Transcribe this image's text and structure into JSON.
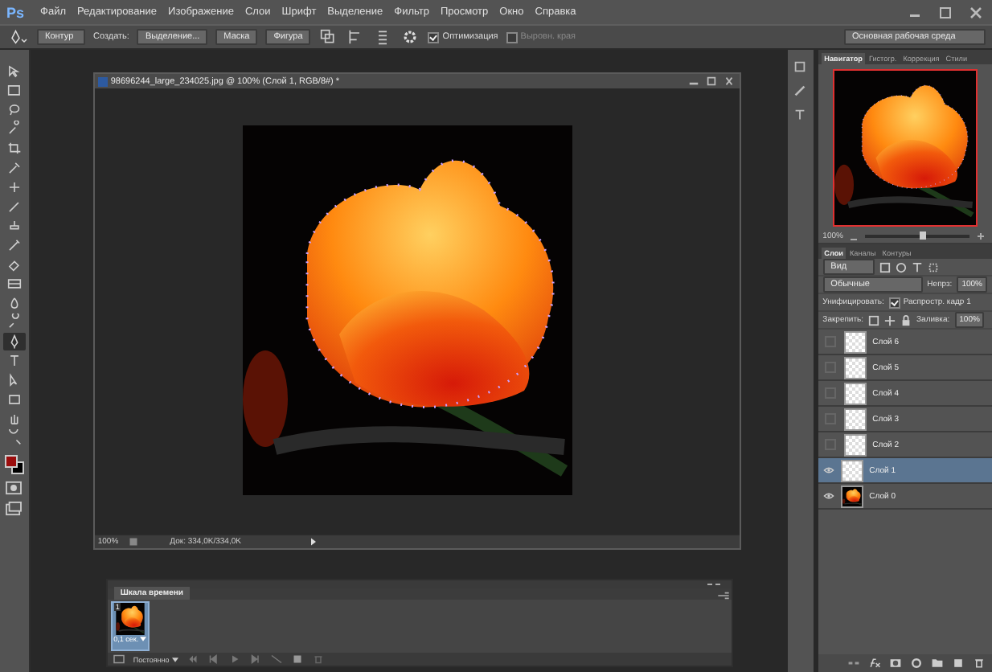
{
  "menu": {
    "logo": "Ps",
    "items": [
      "Файл",
      "Редактирование",
      "Изображение",
      "Слои",
      "Шрифт",
      "Выделение",
      "Фильтр",
      "Просмотр",
      "Окно",
      "Справка"
    ]
  },
  "options_bar": {
    "mode": "Контур",
    "create_label": "Создать:",
    "buttons": [
      "Выделение...",
      "Маска",
      "Фигура"
    ],
    "checkboxes": [
      {
        "label": "Оптимизация",
        "checked": true,
        "disabled": false
      },
      {
        "label": "Выровн. края",
        "checked": false,
        "disabled": true
      }
    ],
    "workspace": "Основная рабочая среда"
  },
  "tools": [
    {
      "selected": false
    },
    {
      "selected": false
    },
    {
      "selected": false
    },
    {
      "selected": false
    },
    {
      "selected": false
    },
    {
      "selected": false
    },
    {
      "selected": false
    },
    {
      "selected": false
    },
    {
      "selected": false
    },
    {
      "selected": false
    },
    {
      "selected": false
    },
    {
      "selected": false
    },
    {
      "selected": false
    },
    {
      "selected": false
    },
    {
      "selected": true
    },
    {
      "selected": false
    },
    {
      "selected": false
    },
    {
      "selected": false
    },
    {
      "selected": false
    },
    {
      "selected": false
    }
  ],
  "document": {
    "title": "98696244_large_234025.jpg @ 100% (Слой 1, RGB/8#) *",
    "zoom": "100%",
    "doc_info": "Док: 334,0K/334,0K"
  },
  "navigator": {
    "tabs": [
      {
        "label": "Навигатор",
        "selected": true
      },
      {
        "label": "Гистогр.",
        "selected": false
      },
      {
        "label": "Коррекция",
        "selected": false
      },
      {
        "label": "Стили",
        "selected": false
      }
    ],
    "zoom": "100%",
    "level": 0.55
  },
  "layers_panel": {
    "tabs": [
      {
        "label": "Слои",
        "selected": true
      },
      {
        "label": "Каналы",
        "selected": false
      },
      {
        "label": "Контуры",
        "selected": false
      }
    ],
    "filter": "Вид",
    "blend_mode": "Обычные",
    "opacity_label": "Непрз:",
    "opacity": "100%",
    "unify_label": "Унифицировать:",
    "propagate": {
      "label": "Распростр. кадр 1",
      "checked": true
    },
    "lock_label": "Закрепить:",
    "fill_label": "Заливка:",
    "fill": "100%",
    "layers": [
      {
        "name": "Слой 6",
        "visible": false,
        "selected": false,
        "kind": "transparent"
      },
      {
        "name": "Слой 5",
        "visible": false,
        "selected": false,
        "kind": "transparent"
      },
      {
        "name": "Слой 4",
        "visible": false,
        "selected": false,
        "kind": "transparent"
      },
      {
        "name": "Слой 3",
        "visible": false,
        "selected": false,
        "kind": "transparent"
      },
      {
        "name": "Слой 2",
        "visible": false,
        "selected": false,
        "kind": "transparent"
      },
      {
        "name": "Слой 1",
        "visible": true,
        "selected": true,
        "kind": "transparent"
      },
      {
        "name": "Слой 0",
        "visible": true,
        "selected": false,
        "kind": "photo"
      }
    ]
  },
  "timeline": {
    "title": "Шкала времени",
    "frames": [
      {
        "number": "1",
        "delay": "0,1 сек.",
        "selected": true
      }
    ],
    "loop": "Постоянно"
  }
}
